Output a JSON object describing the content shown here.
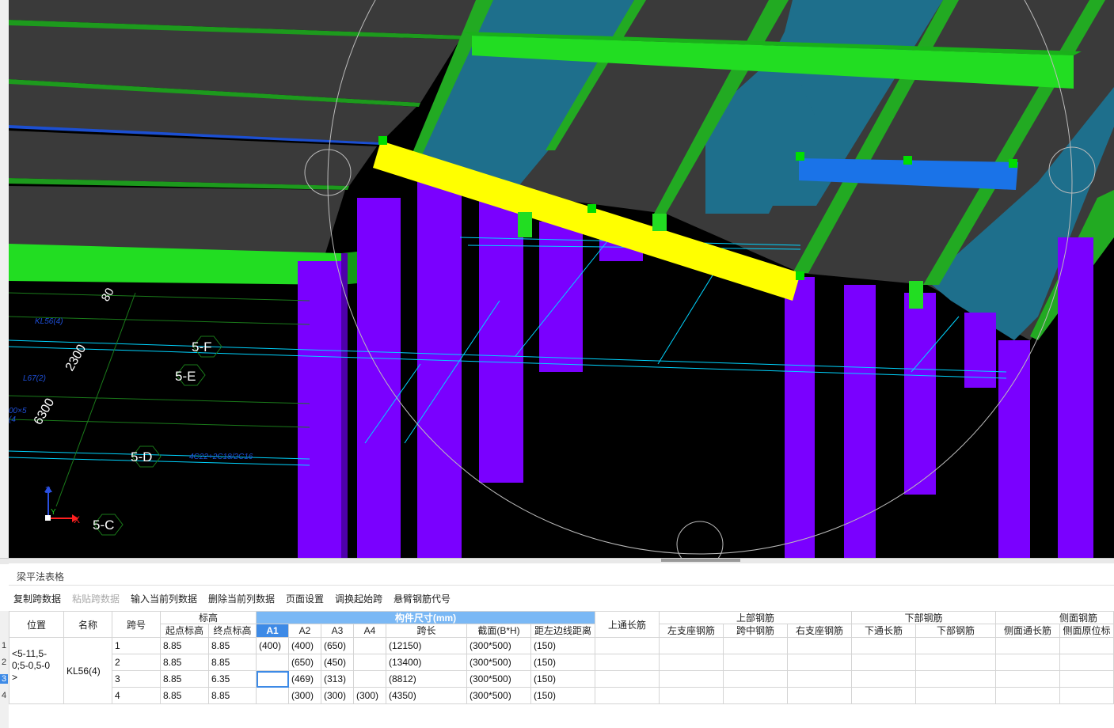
{
  "viewport": {
    "axis_labels": {
      "z": "Z",
      "y": "Y",
      "x": "X"
    },
    "grid_labels": [
      "5-F",
      "5-E",
      "5-D",
      "5-C"
    ],
    "cad_texts": [
      "KL56(4)",
      "L67(2)",
      "2300",
      "6300",
      "4C22+2C18/2C16",
      "00×5",
      "(4",
      "80"
    ],
    "colors": {
      "background": "#000000",
      "slab": "#3a3a3a",
      "beam_green": "#22dd22",
      "column": "#7a00ff",
      "selected_beam": "#ffff00",
      "deck": "#1e6f8c",
      "blue_beam": "#1a73e8",
      "grid_line": "#00d4ff"
    }
  },
  "panel": {
    "title": "梁平法表格",
    "toolbar": [
      {
        "label": "复制跨数据",
        "enabled": true
      },
      {
        "label": "粘贴跨数据",
        "enabled": false
      },
      {
        "label": "输入当前列数据",
        "enabled": true
      },
      {
        "label": "删除当前列数据",
        "enabled": true
      },
      {
        "label": "页面设置",
        "enabled": true
      },
      {
        "label": "调换起始跨",
        "enabled": true
      },
      {
        "label": "悬臂钢筋代号",
        "enabled": true
      }
    ]
  },
  "table": {
    "headers": {
      "position": "位置",
      "name": "名称",
      "span_no": "跨号",
      "elevation": "标高",
      "start_elev": "起点标高",
      "end_elev": "终点标高",
      "member_size": "构件尺寸(mm)",
      "a1": "A1",
      "a2": "A2",
      "a3": "A3",
      "a4": "A4",
      "span_len": "跨长",
      "section": "截面(B*H)",
      "offset": "距左边线距离",
      "top_through": "上通长筋",
      "top_rebar": "上部钢筋",
      "left_support": "左支座钢筋",
      "mid_span": "跨中钢筋",
      "right_support": "右支座钢筋",
      "bottom_rebar": "下部钢筋",
      "bottom_through": "下通长筋",
      "bottom_bars": "下部钢筋",
      "side_rebar": "侧面钢筋",
      "side_through": "侧面通长筋",
      "side_orig": "侧面原位标"
    },
    "position_value": "<5-11,5-0;5-0,5-0>",
    "position_lines": [
      "<5-11,5-",
      "0;5-0,5-0",
      ">"
    ],
    "name_value": "KL56(4)",
    "row_numbers": [
      "1",
      "2",
      "3",
      "4"
    ],
    "rows": [
      {
        "span": "1",
        "start": "8.85",
        "end": "8.85",
        "a1": "(400)",
        "a2": "(400)",
        "a3": "(650)",
        "a4": "",
        "len": "(12150)",
        "section": "(300*500)",
        "offset": "(150)"
      },
      {
        "span": "2",
        "start": "8.85",
        "end": "8.85",
        "a1": "",
        "a2": "(650)",
        "a3": "(450)",
        "a4": "",
        "len": "(13400)",
        "section": "(300*500)",
        "offset": "(150)"
      },
      {
        "span": "3",
        "start": "8.85",
        "end": "6.35",
        "a1": "",
        "a2": "(469)",
        "a3": "(313)",
        "a4": "",
        "len": "(8812)",
        "section": "(300*500)",
        "offset": "(150)"
      },
      {
        "span": "4",
        "start": "8.85",
        "end": "8.85",
        "a1": "",
        "a2": "(300)",
        "a3": "(300)",
        "a4": "(300)",
        "len": "(4350)",
        "section": "(300*500)",
        "offset": "(150)"
      }
    ]
  }
}
